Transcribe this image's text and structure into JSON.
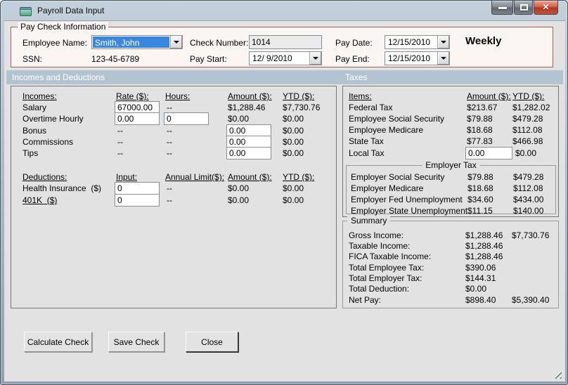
{
  "window": {
    "title": "Payroll Data Input"
  },
  "colors": {
    "group_border_red": "#b25a55",
    "section_bar_blue": "#b4c3d1",
    "selection_blue": "#3b87e0",
    "close_button_red": "#c4503a",
    "form_background": "#e2e2e2"
  },
  "paycheck": {
    "group_label": "Pay Check Information",
    "employee_name": {
      "label": "Employee Name:",
      "value": "Smith, John"
    },
    "ssn": {
      "label": "SSN:",
      "value": "123-45-6789"
    },
    "check_number": {
      "label": "Check Number:",
      "value": "1014"
    },
    "pay_start": {
      "label": "Pay Start:",
      "value": "12/ 9/2010"
    },
    "pay_date": {
      "label": "Pay Date:",
      "value": "12/15/2010"
    },
    "pay_end": {
      "label": "Pay End:",
      "value": "12/15/2010"
    },
    "frequency": "Weekly"
  },
  "sections": {
    "incomes_deductions": "Incomes and Deductions",
    "taxes": "Taxes"
  },
  "incomes": {
    "headers": {
      "item": "Incomes:",
      "rate": "Rate ($):",
      "hours": "Hours:",
      "amount": "Amount ($):",
      "ytd": "YTD ($):"
    },
    "salary": {
      "label": "Salary",
      "rate": "67000.00",
      "hours": "--",
      "amount": "$1,288.46",
      "ytd": "$7,730.76"
    },
    "overtime": {
      "label": "Overtime Hourly",
      "rate": "0.00",
      "hours": "0",
      "amount": "$0.00",
      "ytd": "$0.00"
    },
    "bonus": {
      "label": "Bonus",
      "rate": "--",
      "hours": "--",
      "amount": "0.00",
      "ytd": "$0.00"
    },
    "commissions": {
      "label": "Commissions",
      "rate": "--",
      "hours": "--",
      "amount": "0.00",
      "ytd": "$0.00"
    },
    "tips": {
      "label": "Tips",
      "rate": "--",
      "hours": "--",
      "amount": "0.00",
      "ytd": "$0.00"
    }
  },
  "deductions": {
    "headers": {
      "item": "Deductions:",
      "input": "Input:",
      "limit": "Annual Limit($):",
      "amount": "Amount ($):",
      "ytd": "YTD ($):"
    },
    "health": {
      "label": "Health Insurance  ($)",
      "input": "0",
      "limit": "--",
      "amount": "$0.00",
      "ytd": "$0.00"
    },
    "k401": {
      "label": "401K  ($)",
      "input": "0",
      "limit": "--",
      "amount": "$0.00",
      "ytd": "$0.00"
    }
  },
  "taxes": {
    "headers": {
      "item": "Items:",
      "amount": "Amount ($):",
      "ytd": "YTD ($):"
    },
    "rows": [
      {
        "label": "Federal Tax",
        "amount": "$213.67",
        "ytd": "$1,282.02"
      },
      {
        "label": "Employee Social Security",
        "amount": "$79.88",
        "ytd": "$479.28"
      },
      {
        "label": "Employee Medicare",
        "amount": "$18.68",
        "ytd": "$112.08"
      },
      {
        "label": "State Tax",
        "amount": "$77.83",
        "ytd": "$466.98"
      }
    ],
    "local_tax": {
      "label": "Local Tax",
      "amount": "0.00",
      "ytd": "$0.00"
    },
    "employer": {
      "group_label": "Employer Tax",
      "rows": [
        {
          "label": "Employer Social Security",
          "amount": "$79.88",
          "ytd": "$479.28"
        },
        {
          "label": "Employer Medicare",
          "amount": "$18.68",
          "ytd": "$112.08"
        },
        {
          "label": "Employer Fed Unemployment",
          "amount": "$34.60",
          "ytd": "$434.00"
        },
        {
          "label": "Employer State Unemployment",
          "amount": "$11.15",
          "ytd": "$140.00"
        }
      ]
    }
  },
  "summary": {
    "group_label": "Summary",
    "rows": [
      {
        "label": "Gross Income:",
        "amount": "$1,288.46",
        "ytd": "$7,730.76"
      },
      {
        "label": "Taxable Income:",
        "amount": "$1,288.46",
        "ytd": ""
      },
      {
        "label": "FICA Taxable Income:",
        "amount": "$1,288.46",
        "ytd": ""
      },
      {
        "label": "Total Employee Tax:",
        "amount": "$390.06",
        "ytd": ""
      },
      {
        "label": "Total Employer Tax:",
        "amount": "$144.31",
        "ytd": ""
      },
      {
        "label": "Total Deduction:",
        "amount": "$0.00",
        "ytd": ""
      },
      {
        "label": "Net Pay:",
        "amount": "$898.40",
        "ytd": "$5,390.40"
      }
    ]
  },
  "buttons": {
    "calculate": "Calculate Check",
    "save": "Save Check",
    "close": "Close"
  }
}
